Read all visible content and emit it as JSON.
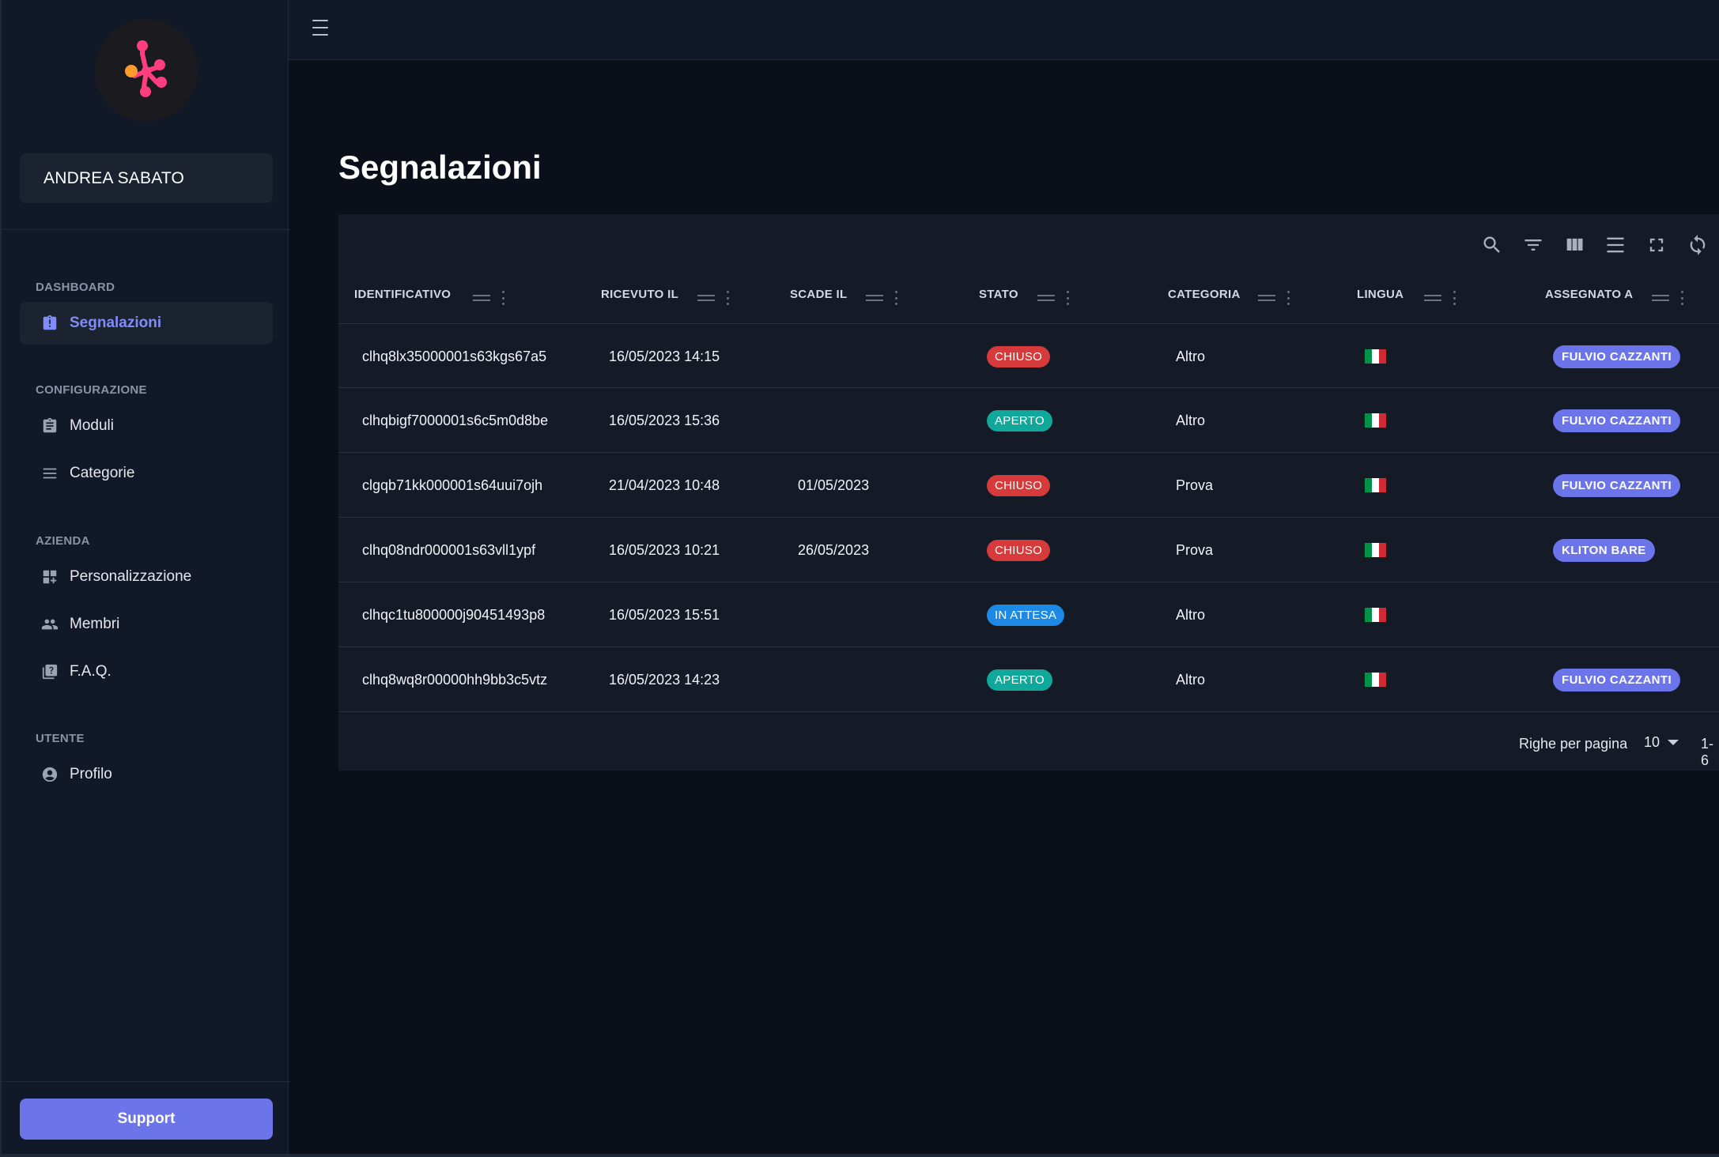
{
  "sidebar": {
    "user_name": "ANDREA SABATO",
    "sections": [
      {
        "title": "DASHBOARD",
        "items": [
          {
            "label": "Segnalazioni",
            "icon": "clipboard-alert-icon",
            "active": true
          }
        ]
      },
      {
        "title": "CONFIGURAZIONE",
        "items": [
          {
            "label": "Moduli",
            "icon": "clipboard-list-icon"
          },
          {
            "label": "Categorie",
            "icon": "list-icon"
          }
        ]
      },
      {
        "title": "AZIENDA",
        "items": [
          {
            "label": "Personalizzazione",
            "icon": "dashboard-customize-icon"
          },
          {
            "label": "Membri",
            "icon": "people-icon"
          },
          {
            "label": "F.A.Q.",
            "icon": "quiz-icon"
          }
        ]
      },
      {
        "title": "UTENTE",
        "items": [
          {
            "label": "Profilo",
            "icon": "account-circle-icon"
          }
        ]
      }
    ],
    "support_label": "Support"
  },
  "page": {
    "title": "Segnalazioni"
  },
  "table": {
    "toolbar": [
      "search-icon",
      "filter-icon",
      "columns-icon",
      "density-icon",
      "fullscreen-icon",
      "refresh-icon"
    ],
    "columns": [
      "IDENTIFICATIVO",
      "RICEVUTO IL",
      "SCADE IL",
      "STATO",
      "CATEGORIA",
      "LINGUA",
      "ASSEGNATO A"
    ],
    "rows": [
      {
        "id": "clhq8lx35000001s63kgs67a5",
        "received": "16/05/2023 14:15",
        "due": "",
        "status": "CHIUSO",
        "category": "Altro",
        "language": "italian-flag",
        "assignee": "FULVIO CAZZANTI"
      },
      {
        "id": "clhqbigf7000001s6c5m0d8be",
        "received": "16/05/2023 15:36",
        "due": "",
        "status": "APERTO",
        "category": "Altro",
        "language": "italian-flag",
        "assignee": "FULVIO CAZZANTI"
      },
      {
        "id": "clgqb71kk000001s64uui7ojh",
        "received": "21/04/2023 10:48",
        "due": "01/05/2023",
        "status": "CHIUSO",
        "category": "Prova",
        "language": "italian-flag",
        "assignee": "FULVIO CAZZANTI"
      },
      {
        "id": "clhq08ndr000001s63vll1ypf",
        "received": "16/05/2023 10:21",
        "due": "26/05/2023",
        "status": "CHIUSO",
        "category": "Prova",
        "language": "italian-flag",
        "assignee": "KLITON BARE"
      },
      {
        "id": "clhqc1tu800000j90451493p8",
        "received": "16/05/2023 15:51",
        "due": "",
        "status": "IN ATTESA",
        "category": "Altro",
        "language": "italian-flag",
        "assignee": ""
      },
      {
        "id": "clhq8wq8r00000hh9bb3c5vtz",
        "received": "16/05/2023 14:23",
        "due": "",
        "status": "APERTO",
        "category": "Altro",
        "language": "italian-flag",
        "assignee": "FULVIO CAZZANTI"
      }
    ],
    "footer": {
      "rows_per_page_label": "Righe per pagina",
      "rows_per_page": "10",
      "range": "1-6"
    }
  },
  "colors": {
    "accent": "#6b74e8",
    "active_nav_text": "#818cf8",
    "status_closed": "#d63a3a",
    "status_open": "#0fa89a",
    "status_waiting": "#1e88e5"
  }
}
